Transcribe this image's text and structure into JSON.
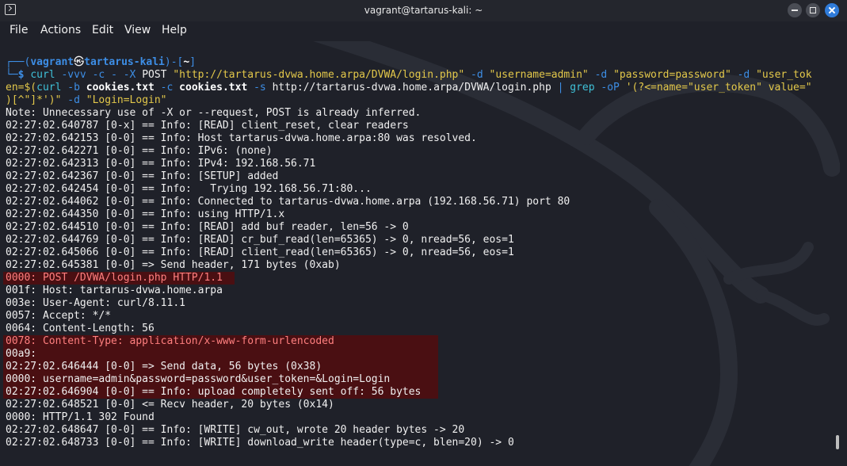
{
  "window": {
    "title": "vagrant@tartarus-kali: ~"
  },
  "menu": {
    "file": "File",
    "actions": "Actions",
    "edit": "Edit",
    "view": "View",
    "help": "Help"
  },
  "prompt": {
    "corner_top": "┌──(",
    "user": "vagrant",
    "at_symbol": "㉿",
    "host": "tartarus-kali",
    "bracket_mid": ")-[",
    "dir": "~",
    "bracket_end": "]",
    "corner_bottom": "└─",
    "dollar": "$"
  },
  "command": {
    "line1": [
      {
        "t": "curl",
        "c": "cyan"
      },
      {
        "t": " -vvv -c - -X ",
        "c": "blue"
      },
      {
        "t": "POST",
        "c": "white"
      },
      {
        "t": " ",
        "c": "white"
      },
      {
        "t": "\"http://tartarus-dvwa.home.arpa/DVWA/login.php\"",
        "c": "yellow"
      },
      {
        "t": " -d ",
        "c": "blue"
      },
      {
        "t": "\"username=admin\"",
        "c": "yellow"
      },
      {
        "t": " -d ",
        "c": "blue"
      },
      {
        "t": "\"password=password\"",
        "c": "yellow"
      },
      {
        "t": " -d ",
        "c": "blue"
      },
      {
        "t": "\"user_tok",
        "c": "yellow"
      }
    ],
    "line2": [
      {
        "t": "en=",
        "c": "yellow"
      },
      {
        "t": "$(",
        "c": "yellow"
      },
      {
        "t": "curl",
        "c": "cyan"
      },
      {
        "t": " -b ",
        "c": "blue"
      },
      {
        "t": "cookies.txt",
        "c": "bright"
      },
      {
        "t": " -c ",
        "c": "blue"
      },
      {
        "t": "cookies.txt",
        "c": "bright"
      },
      {
        "t": " -s ",
        "c": "blue"
      },
      {
        "t": "http://tartarus-dvwa.home.arpa/DVWA/login.php",
        "c": "white"
      },
      {
        "t": " | ",
        "c": "blue"
      },
      {
        "t": "grep",
        "c": "cyan"
      },
      {
        "t": " -oP ",
        "c": "blue"
      },
      {
        "t": "'(?<=name=\"user_token\" value=\"",
        "c": "yellow"
      }
    ],
    "line3": [
      {
        "t": ")[^\"]*'",
        "c": "yellow"
      },
      {
        "t": ")\"",
        "c": "yellow"
      },
      {
        "t": " -d ",
        "c": "blue"
      },
      {
        "t": "\"Login=Login\"",
        "c": "yellow"
      }
    ]
  },
  "output": [
    {
      "text": "Note: Unnecessary use of -X or --request, POST is already inferred.",
      "c": "white"
    },
    {
      "text": "02:27:02.640787 [0-x] == Info: [READ] client_reset, clear readers",
      "c": "white"
    },
    {
      "text": "02:27:02.642153 [0-0] == Info: Host tartarus-dvwa.home.arpa:80 was resolved.",
      "c": "white"
    },
    {
      "text": "02:27:02.642271 [0-0] == Info: IPv6: (none)",
      "c": "white"
    },
    {
      "text": "02:27:02.642313 [0-0] == Info: IPv4: 192.168.56.71",
      "c": "white"
    },
    {
      "text": "02:27:02.642367 [0-0] == Info: [SETUP] added",
      "c": "white"
    },
    {
      "text": "02:27:02.642454 [0-0] == Info:   Trying 192.168.56.71:80...",
      "c": "white"
    },
    {
      "text": "02:27:02.644062 [0-0] == Info: Connected to tartarus-dvwa.home.arpa (192.168.56.71) port 80",
      "c": "white"
    },
    {
      "text": "02:27:02.644350 [0-0] == Info: using HTTP/1.x",
      "c": "white"
    },
    {
      "text": "02:27:02.644510 [0-0] == Info: [READ] add buf reader, len=56 -> 0",
      "c": "white"
    },
    {
      "text": "02:27:02.644769 [0-0] == Info: [READ] cr_buf_read(len=65365) -> 0, nread=56, eos=1",
      "c": "white"
    },
    {
      "text": "02:27:02.645066 [0-0] == Info: [READ] client_read(len=65365) -> 0, nread=56, eos=1",
      "c": "white"
    },
    {
      "text": "02:27:02.645381 [0-0] => Send header, 171 bytes (0xab)",
      "c": "white"
    },
    {
      "text": "0000: POST /DVWA/login.php HTTP/1.1",
      "c": "salmon"
    },
    {
      "text": "001f: Host: tartarus-dvwa.home.arpa",
      "c": "white"
    },
    {
      "text": "003e: User-Agent: curl/8.11.1",
      "c": "white"
    },
    {
      "text": "0057: Accept: */*",
      "c": "white"
    },
    {
      "text": "0064: Content-Length: 56",
      "c": "white"
    },
    {
      "text": "0078: Content-Type: application/x-www-form-urlencoded",
      "c": "salmon"
    },
    {
      "text": "00a9:",
      "c": "white"
    },
    {
      "text": "02:27:02.646444 [0-0] => Send data, 56 bytes (0x38)",
      "c": "white"
    },
    {
      "text": "0000: username=admin&password=password&user_token=&Login=Login",
      "c": "white"
    },
    {
      "text": "02:27:02.646904 [0-0] == Info: upload completely sent off: 56 bytes",
      "c": "white"
    },
    {
      "text": "02:27:02.648521 [0-0] <= Recv header, 20 bytes (0x14)",
      "c": "white"
    },
    {
      "text": "0000: HTTP/1.1 302 Found",
      "c": "white"
    },
    {
      "text": "02:27:02.648647 [0-0] == Info: [WRITE] cw_out, wrote 20 header bytes -> 20",
      "c": "white"
    },
    {
      "text": "02:27:02.648733 [0-0] == Info: [WRITE] download_write header(type=c, blen=20) -> 0",
      "c": "white"
    }
  ]
}
